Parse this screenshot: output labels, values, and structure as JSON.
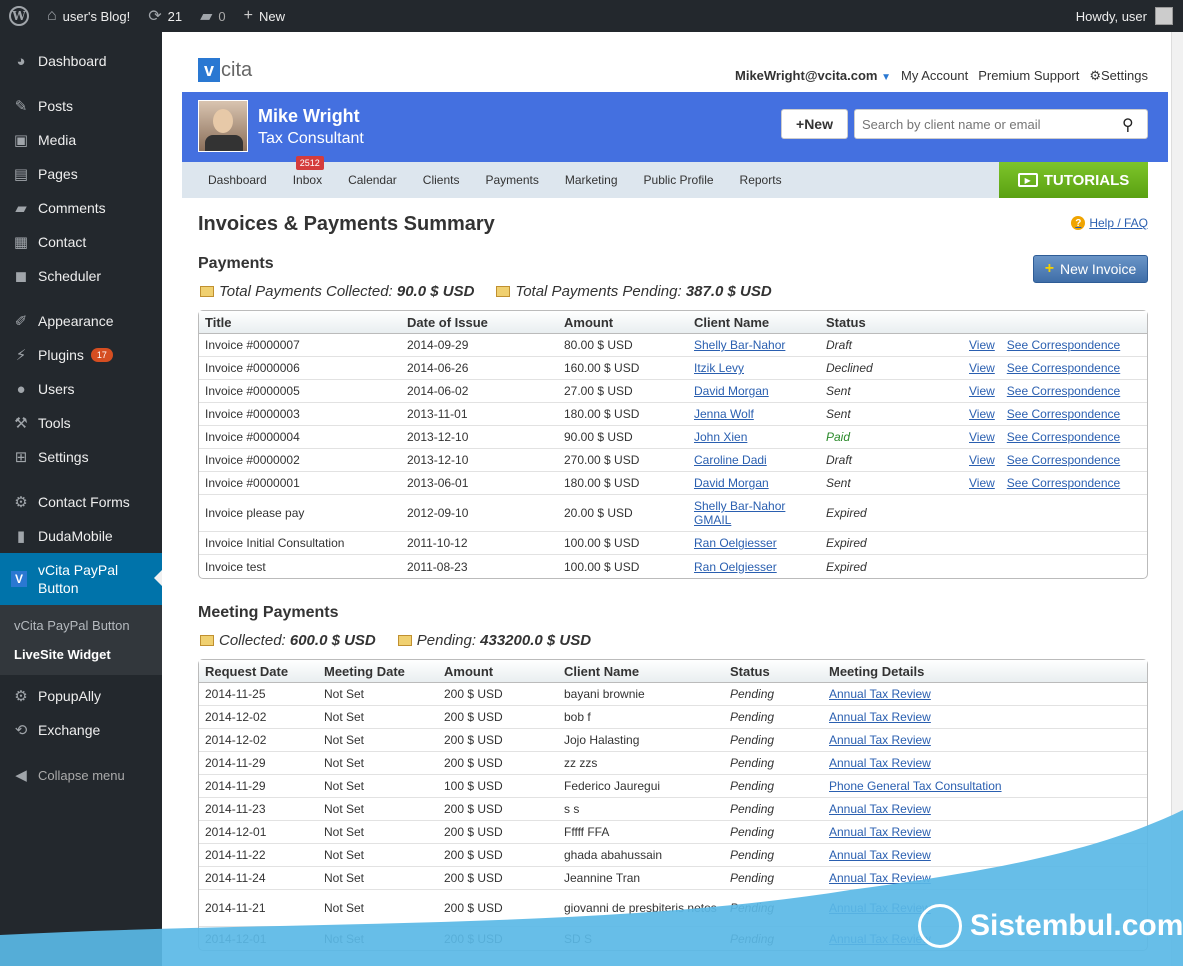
{
  "adminbar": {
    "site": "user's Blog!",
    "updates": "21",
    "comments": "0",
    "new": "New",
    "howdy": "Howdy, user"
  },
  "menu": {
    "items": [
      {
        "label": "Dashboard",
        "icon": "dashboard-icon"
      },
      {
        "label": "Posts",
        "icon": "pin-icon"
      },
      {
        "label": "Media",
        "icon": "media-icon"
      },
      {
        "label": "Pages",
        "icon": "pages-icon"
      },
      {
        "label": "Comments",
        "icon": "comments-icon"
      },
      {
        "label": "Contact",
        "icon": "contact-icon"
      },
      {
        "label": "Scheduler",
        "icon": "scheduler-icon"
      },
      {
        "label": "Appearance",
        "icon": "appearance-icon"
      },
      {
        "label": "Plugins",
        "icon": "plugins-icon",
        "badge": "17"
      },
      {
        "label": "Users",
        "icon": "users-icon"
      },
      {
        "label": "Tools",
        "icon": "tools-icon"
      },
      {
        "label": "Settings",
        "icon": "settings-icon"
      },
      {
        "label": "Contact Forms",
        "icon": "contact-forms-icon"
      },
      {
        "label": "DudaMobile",
        "icon": "mobile-icon"
      },
      {
        "label": "vCita PayPal Button",
        "icon": "vcita-icon"
      },
      {
        "label": "PopupAlly",
        "icon": "popupally-icon"
      },
      {
        "label": "Exchange",
        "icon": "exchange-icon"
      }
    ],
    "submenu": [
      "vCita PayPal Button",
      "LiveSite Widget"
    ],
    "collapse": "Collapse menu"
  },
  "vcita": {
    "logo": "cita",
    "email": "MikeWright@vcita.com",
    "my_account": "My Account",
    "premium_support": "Premium Support",
    "settings": "Settings",
    "profile_name": "Mike Wright",
    "profile_role": "Tax Consultant",
    "new_button": "New",
    "search_placeholder": "Search by client name or email",
    "nav": [
      "Dashboard",
      "Inbox",
      "Calendar",
      "Clients",
      "Payments",
      "Marketing",
      "Public Profile",
      "Reports"
    ],
    "inbox_badge": "2512",
    "tutorials": "TUTORIALS",
    "page_title": "Invoices & Payments Summary",
    "help": "Help / FAQ"
  },
  "payments": {
    "title": "Payments",
    "collected_label": "Total Payments Collected:",
    "collected_value": "90.0 $ USD",
    "pending_label": "Total Payments Pending:",
    "pending_value": "387.0 $ USD",
    "new_invoice": "New Invoice",
    "headers": [
      "Title",
      "Date of Issue",
      "Amount",
      "Client Name",
      "Status"
    ],
    "view": "View",
    "corr": "See Correspondence",
    "rows": [
      {
        "title": "Invoice #0000007",
        "date": "2014-09-29",
        "amount": "80.00 $ USD",
        "client": "Shelly Bar-Nahor",
        "status": "Draft",
        "actions": true
      },
      {
        "title": "Invoice #0000006",
        "date": "2014-06-26",
        "amount": "160.00 $ USD",
        "client": "Itzik Levy",
        "status": "Declined",
        "actions": true
      },
      {
        "title": "Invoice #0000005",
        "date": "2014-06-02",
        "amount": "27.00 $ USD",
        "client": "David Morgan",
        "status": "Sent",
        "actions": true
      },
      {
        "title": "Invoice #0000003",
        "date": "2013-11-01",
        "amount": "180.00 $ USD",
        "client": "Jenna Wolf",
        "status": "Sent",
        "actions": true
      },
      {
        "title": "Invoice #0000004",
        "date": "2013-12-10",
        "amount": "90.00 $ USD",
        "client": "John Xien",
        "status": "Paid",
        "actions": true
      },
      {
        "title": "Invoice #0000002",
        "date": "2013-12-10",
        "amount": "270.00 $ USD",
        "client": "Caroline Dadi",
        "status": "Draft",
        "actions": true
      },
      {
        "title": "Invoice #0000001",
        "date": "2013-06-01",
        "amount": "180.00 $ USD",
        "client": "David Morgan",
        "status": "Sent",
        "actions": true
      },
      {
        "title": "Invoice please pay",
        "date": "2012-09-10",
        "amount": "20.00 $ USD",
        "client": "Shelly Bar-Nahor GMAIL",
        "status": "Expired",
        "actions": false
      },
      {
        "title": "Invoice Initial Consultation",
        "date": "2011-10-12",
        "amount": "100.00 $ USD",
        "client": "Ran Oelgiesser",
        "status": "Expired",
        "actions": false
      },
      {
        "title": "Invoice test",
        "date": "2011-08-23",
        "amount": "100.00 $ USD",
        "client": "Ran Oelgiesser",
        "status": "Expired",
        "actions": false
      }
    ]
  },
  "meetings": {
    "title": "Meeting Payments",
    "collected_label": "Collected:",
    "collected_value": "600.0 $ USD",
    "pending_label": "Pending:",
    "pending_value": "433200.0 $ USD",
    "headers": [
      "Request Date",
      "Meeting Date",
      "Amount",
      "Client Name",
      "Status",
      "Meeting Details"
    ],
    "rows": [
      {
        "req": "2014-11-25",
        "meet": "Not Set",
        "amount": "200 $ USD",
        "client": "bayani brownie",
        "status": "Pending",
        "details": "Annual Tax Review"
      },
      {
        "req": "2014-12-02",
        "meet": "Not Set",
        "amount": "200 $ USD",
        "client": "bob f",
        "status": "Pending",
        "details": "Annual Tax Review"
      },
      {
        "req": "2014-12-02",
        "meet": "Not Set",
        "amount": "200 $ USD",
        "client": "Jojo Halasting",
        "status": "Pending",
        "details": "Annual Tax Review"
      },
      {
        "req": "2014-11-29",
        "meet": "Not Set",
        "amount": "200 $ USD",
        "client": "zz zzs",
        "status": "Pending",
        "details": "Annual Tax Review"
      },
      {
        "req": "2014-11-29",
        "meet": "Not Set",
        "amount": "100 $ USD",
        "client": "Federico Jauregui",
        "status": "Pending",
        "details": "Phone General Tax Consultation"
      },
      {
        "req": "2014-11-23",
        "meet": "Not Set",
        "amount": "200 $ USD",
        "client": "s s",
        "status": "Pending",
        "details": "Annual Tax Review"
      },
      {
        "req": "2014-12-01",
        "meet": "Not Set",
        "amount": "200 $ USD",
        "client": "Fffff FFA",
        "status": "Pending",
        "details": "Annual Tax Review"
      },
      {
        "req": "2014-11-22",
        "meet": "Not Set",
        "amount": "200 $ USD",
        "client": "ghada abahussain",
        "status": "Pending",
        "details": "Annual Tax Review"
      },
      {
        "req": "2014-11-24",
        "meet": "Not Set",
        "amount": "200 $ USD",
        "client": "Jeannine Tran",
        "status": "Pending",
        "details": "Annual Tax Review"
      },
      {
        "req": "2014-11-21",
        "meet": "Not Set",
        "amount": "200 $ USD",
        "client": "giovanni de presbiteris netos",
        "status": "Pending",
        "details": "Annual Tax Review"
      },
      {
        "req": "2014-12-01",
        "meet": "Not Set",
        "amount": "200 $ USD",
        "client": "SD S",
        "status": "Pending",
        "details": "Annual Tax Review"
      }
    ]
  },
  "watermark": "Sistembul.com",
  "colors": {
    "accent": "#0073aa",
    "header": "#4470e0",
    "tutorials": "#6cb21f",
    "wave": "#5ab8e6"
  }
}
